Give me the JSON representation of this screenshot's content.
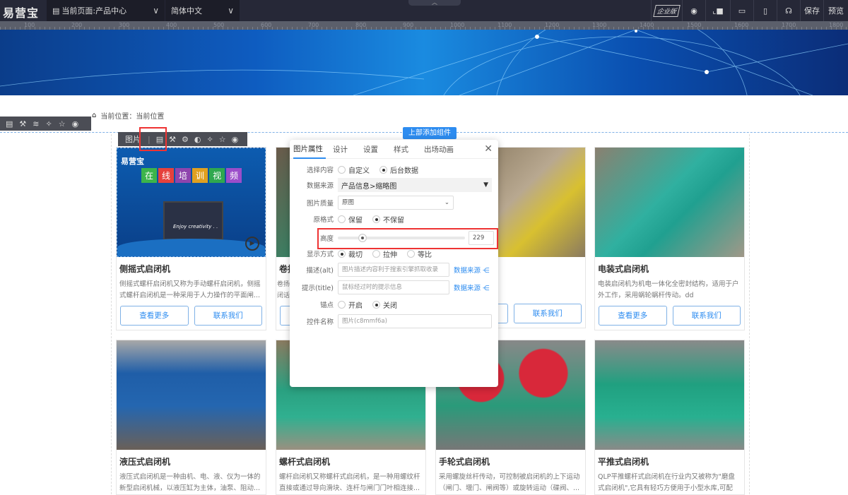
{
  "topbar": {
    "logo": "易营宝",
    "page_select": "当前页面:产品中心",
    "lang_select": "简体中文",
    "edition": "企业版",
    "save": "保存",
    "preview": "预览"
  },
  "ruler": [
    "100",
    "200",
    "300",
    "400",
    "500",
    "600",
    "700",
    "800",
    "900",
    "1000",
    "1100",
    "1200",
    "1300",
    "1400",
    "1500",
    "1600",
    "1700",
    "1800"
  ],
  "breadcrumb": "当前位置：当前位置",
  "add_top_button": "上部添加组件",
  "card_toolbar_label": "图片",
  "first_image": {
    "brand": "易营宝",
    "chars": [
      "在",
      "线",
      "培",
      "训",
      "视",
      "频"
    ],
    "caption": "Enjoy creativity . ."
  },
  "cards": [
    {
      "title": "侧摇式启闭机",
      "desc": "侧摇式螺杆启闭机又称为手动螺杆启闭机，侧摇式螺杆启闭机是一种采用于人力操作的平面闸...",
      "more": "查看更多",
      "contact": "联系我们"
    },
    {
      "title": "卷扬",
      "desc": "卷扬闭话",
      "more": "",
      "contact": ""
    },
    {
      "title": "",
      "desc": "",
      "more": "",
      "contact": "联系我们"
    },
    {
      "title": "电装式启闭机",
      "desc": "电装启闭机为机电一体化全密封结构，适用于户外工作，采用蜗轮蜗杆传动。dd",
      "more": "查看更多",
      "contact": "联系我们"
    },
    {
      "title": "液压式启闭机",
      "desc": "液压式启闭机是一种由机、电、液、仪为一体的新型启闭机械，以液压缸为主体，油泵、阻动..."
    },
    {
      "title": "螺杆式启闭机",
      "desc": "螺杆启闭机又称螺杆式启闭机，是一种用螺纹杆直接或通过导向滑块、连杆与闸门门叶相连接..."
    },
    {
      "title": "手轮式启闭机",
      "desc": "采用螺旋丝杆传动，可控制被启闭机的上下运动（闸门、堰门、闸阀等）或旋转运动（碟阀、..."
    },
    {
      "title": "平推式启闭机",
      "desc": "QLP平推螺杆式启闭机在行业内又被称为\"磨盘式启闭机\",它具有轻巧方便用于小型水库,可配备..."
    }
  ],
  "panel": {
    "tabs": [
      "图片属性",
      "设计",
      "设置",
      "样式",
      "出场动画"
    ],
    "select_content": {
      "label": "选择内容",
      "options": [
        "自定义",
        "后台数据"
      ],
      "selected": "后台数据"
    },
    "data_source": {
      "label": "数据来源",
      "value": "产品信息>缩略图"
    },
    "quality": {
      "label": "图片质量",
      "value": "原图"
    },
    "original_format": {
      "label": "原格式",
      "options": [
        "保留",
        "不保留"
      ],
      "selected": "不保留"
    },
    "height": {
      "label": "高度",
      "value": "229",
      "slider_fraction": 0.16
    },
    "display": {
      "label": "显示方式",
      "options": [
        "裁切",
        "拉伸",
        "等比"
      ],
      "selected": "裁切"
    },
    "alt": {
      "label": "描述(alt)",
      "placeholder": "图片描述内容利于搜索引擎抓取收录",
      "link": "数据来源"
    },
    "title": {
      "label": "提示(title)",
      "placeholder": "鼠标经过时的提示信息",
      "link": "数据来源"
    },
    "anchor": {
      "label": "锚点",
      "options": [
        "开启",
        "关闭"
      ],
      "selected": "关闭"
    },
    "control_name": {
      "label": "控件名称",
      "placeholder": "图片(c8mmf6a)"
    }
  }
}
